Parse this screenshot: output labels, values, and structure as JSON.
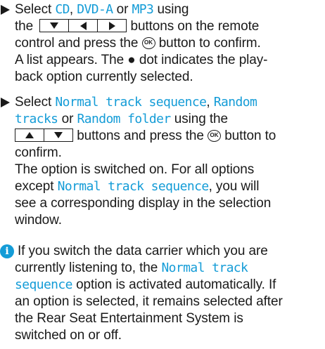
{
  "colors": {
    "accent": "#149cd7",
    "text": "#1a1a1a"
  },
  "icons": {
    "bullet": "arrow-bullet-icon",
    "info": "info-icon",
    "ok_button": "ok-button-icon",
    "keys": [
      "down-key-icon",
      "left-key-icon",
      "right-key-icon",
      "up-key-icon"
    ]
  },
  "step1": {
    "select": "Select",
    "cd": "CD",
    "comma": ",",
    "dvda": "DVD-A",
    "or": "or",
    "mp3": "MP3",
    "using": "using",
    "the": "the",
    "buttons_on_remote": "buttons on the remote",
    "control_and_press": "control and press the",
    "ok_label": "OK",
    "button_to_confirm": "button to confirm.",
    "list_appears": "A list appears. The ● dot indicates the play-",
    "back_option": "back option currently selected."
  },
  "step2": {
    "select": "Select",
    "normal_track_sequence": "Normal track sequence",
    "comma": ",",
    "random_tracks_1": "Random",
    "random_tracks_2": "tracks",
    "or": "or",
    "random_folder": "Random folder",
    "using_the": "using the",
    "buttons_and_press": "buttons and press the",
    "ok_label": "OK",
    "button_to": "button to",
    "confirm": "confirm.",
    "switched_on": "The option is switched on. For all options",
    "except": "except",
    "normal_track_sequence_2": "Normal track sequence",
    "you_will": ", you will",
    "corresponding": "see a corresponding display in the selection",
    "window": "window."
  },
  "note": {
    "line1": "If you switch the data carrier which you are",
    "line2a": "currently listening to, the",
    "normal_track_1": "Normal track",
    "sequence": "sequence",
    "line3b": "option is activated automatically. If",
    "line4": "an option is selected, it remains selected after",
    "line5": "the Rear Seat Entertainment System is",
    "line6": "switched on or off."
  }
}
